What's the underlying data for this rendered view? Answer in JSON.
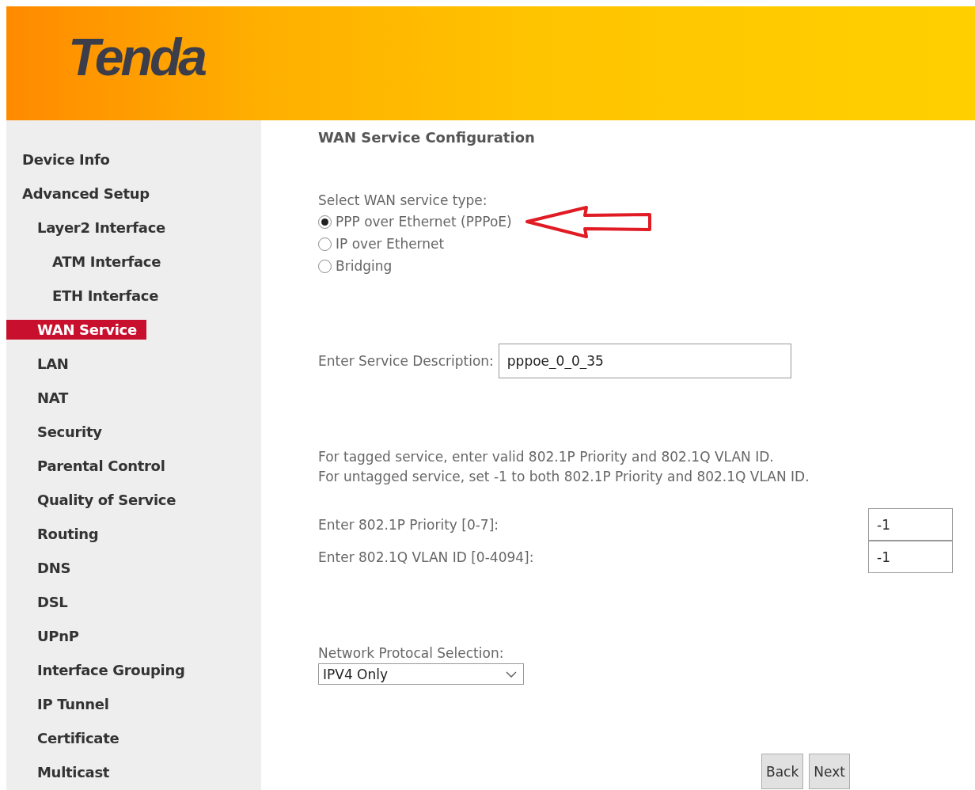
{
  "header": {
    "logo": "Tenda"
  },
  "sidebar": {
    "items": [
      {
        "label": "Device Info",
        "selected": false
      },
      {
        "label": "Advanced Setup",
        "selected": false,
        "children": [
          {
            "label": "Layer2 Interface",
            "selected": false,
            "children": [
              {
                "label": "ATM Interface",
                "selected": false
              },
              {
                "label": "ETH Interface",
                "selected": false
              }
            ]
          },
          {
            "label": "WAN Service",
            "selected": true
          },
          {
            "label": "LAN",
            "selected": false
          },
          {
            "label": "NAT",
            "selected": false
          },
          {
            "label": "Security",
            "selected": false
          },
          {
            "label": "Parental Control",
            "selected": false
          },
          {
            "label": "Quality of Service",
            "selected": false
          },
          {
            "label": "Routing",
            "selected": false
          },
          {
            "label": "DNS",
            "selected": false
          },
          {
            "label": "DSL",
            "selected": false
          },
          {
            "label": "UPnP",
            "selected": false
          },
          {
            "label": "Interface Grouping",
            "selected": false
          },
          {
            "label": "IP Tunnel",
            "selected": false
          },
          {
            "label": "Certificate",
            "selected": false
          },
          {
            "label": "Multicast",
            "selected": false
          }
        ]
      }
    ]
  },
  "main": {
    "title": "WAN Service Configuration",
    "service_type": {
      "label": "Select WAN service type:",
      "options": [
        {
          "label": "PPP over Ethernet (PPPoE)",
          "selected": true
        },
        {
          "label": "IP over Ethernet",
          "selected": false
        },
        {
          "label": "Bridging",
          "selected": false
        }
      ]
    },
    "service_description": {
      "label": "Enter Service Description:",
      "value": "pppoe_0_0_35"
    },
    "note": [
      "For tagged service, enter valid 802.1P Priority and 802.1Q VLAN ID.",
      "For untagged service, set -1 to both 802.1P Priority and 802.1Q VLAN ID."
    ],
    "vlan_fields": [
      {
        "label": "Enter 802.1P Priority [0-7]:",
        "value": "-1"
      },
      {
        "label": "Enter 802.1Q VLAN ID [0-4094]:",
        "value": "-1"
      }
    ],
    "protocol": {
      "label": "Network Protocal Selection:",
      "value": "IPV4 Only"
    },
    "buttons": [
      "Back",
      "Next"
    ]
  }
}
